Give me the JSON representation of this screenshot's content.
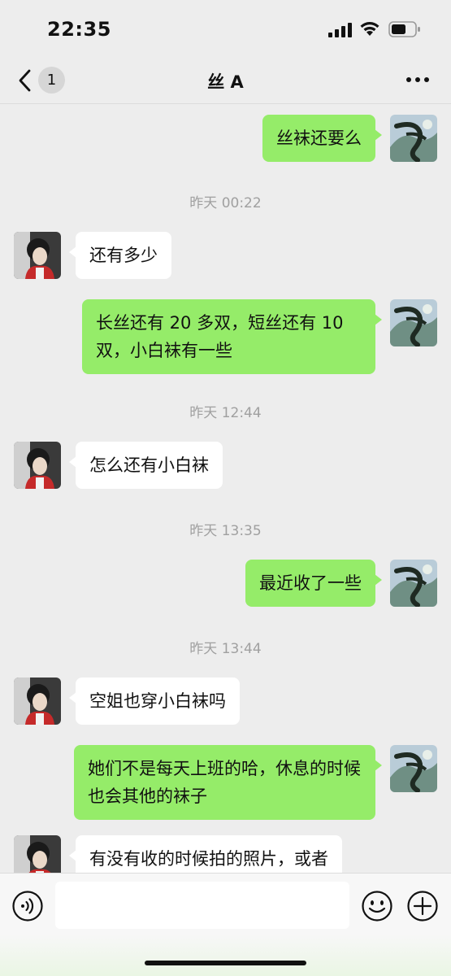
{
  "status_bar": {
    "time": "22:35"
  },
  "nav": {
    "unread_count": "1",
    "title": "丝 A"
  },
  "messages": [
    {
      "text": "丝袜还要么"
    },
    {
      "text": "还有多少"
    },
    {
      "text": "长丝还有 20 多双，短丝还有 10 双，小白袜有一些"
    },
    {
      "text": "怎么还有小白袜"
    },
    {
      "text": "最近收了一些"
    },
    {
      "text": "空姐也穿小白袜吗"
    },
    {
      "text": "她们不是每天上班的哈，休息的时候也会其他的袜子"
    },
    {
      "text": "有没有收的时候拍的照片，或者"
    }
  ],
  "timestamps": [
    "昨天 00:22",
    "昨天 12:44",
    "昨天 13:35",
    "昨天 13:44"
  ],
  "input": {
    "placeholder": ""
  },
  "colors": {
    "outgoing_bubble": "#95ec69",
    "incoming_bubble": "#ffffff",
    "background": "#ededed"
  },
  "icons": [
    "back-chevron-icon",
    "more-icon",
    "voice-icon",
    "emoji-icon",
    "plus-icon"
  ]
}
